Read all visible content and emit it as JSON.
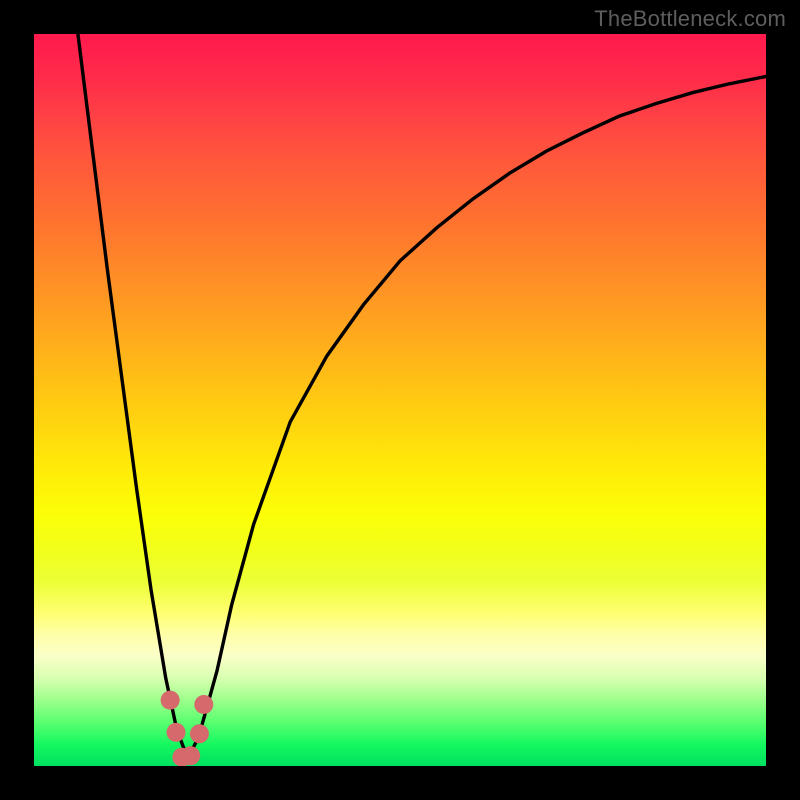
{
  "watermark": "TheBottleneck.com",
  "chart_data": {
    "type": "line",
    "title": "",
    "xlabel": "",
    "ylabel": "",
    "xlim": [
      0,
      100
    ],
    "ylim": [
      0,
      100
    ],
    "grid": false,
    "series": [
      {
        "name": "bottleneck-curve",
        "x": [
          6,
          8,
          10,
          12,
          14,
          16,
          18,
          19.5,
          21,
          22.5,
          25,
          27,
          30,
          35,
          40,
          45,
          50,
          55,
          60,
          65,
          70,
          75,
          80,
          85,
          90,
          95,
          100
        ],
        "y": [
          100,
          84,
          68,
          53,
          38,
          24,
          12,
          5,
          1,
          4,
          13,
          22,
          33,
          47,
          56,
          63,
          69,
          73.5,
          77.5,
          81,
          84,
          86.5,
          88.8,
          90.5,
          92,
          93.2,
          94.2
        ]
      }
    ],
    "markers": [
      {
        "name": "left-ascend-marker",
        "x": 18.6,
        "y": 9.0
      },
      {
        "name": "left-lower-marker",
        "x": 19.4,
        "y": 4.6
      },
      {
        "name": "trough-left-marker",
        "x": 20.2,
        "y": 1.2
      },
      {
        "name": "trough-right-marker",
        "x": 21.4,
        "y": 1.4
      },
      {
        "name": "right-lower-marker",
        "x": 22.6,
        "y": 4.4
      },
      {
        "name": "right-ascend-marker",
        "x": 23.2,
        "y": 8.4
      }
    ],
    "marker_color": "#d5696c",
    "curve_color": "#000000"
  }
}
